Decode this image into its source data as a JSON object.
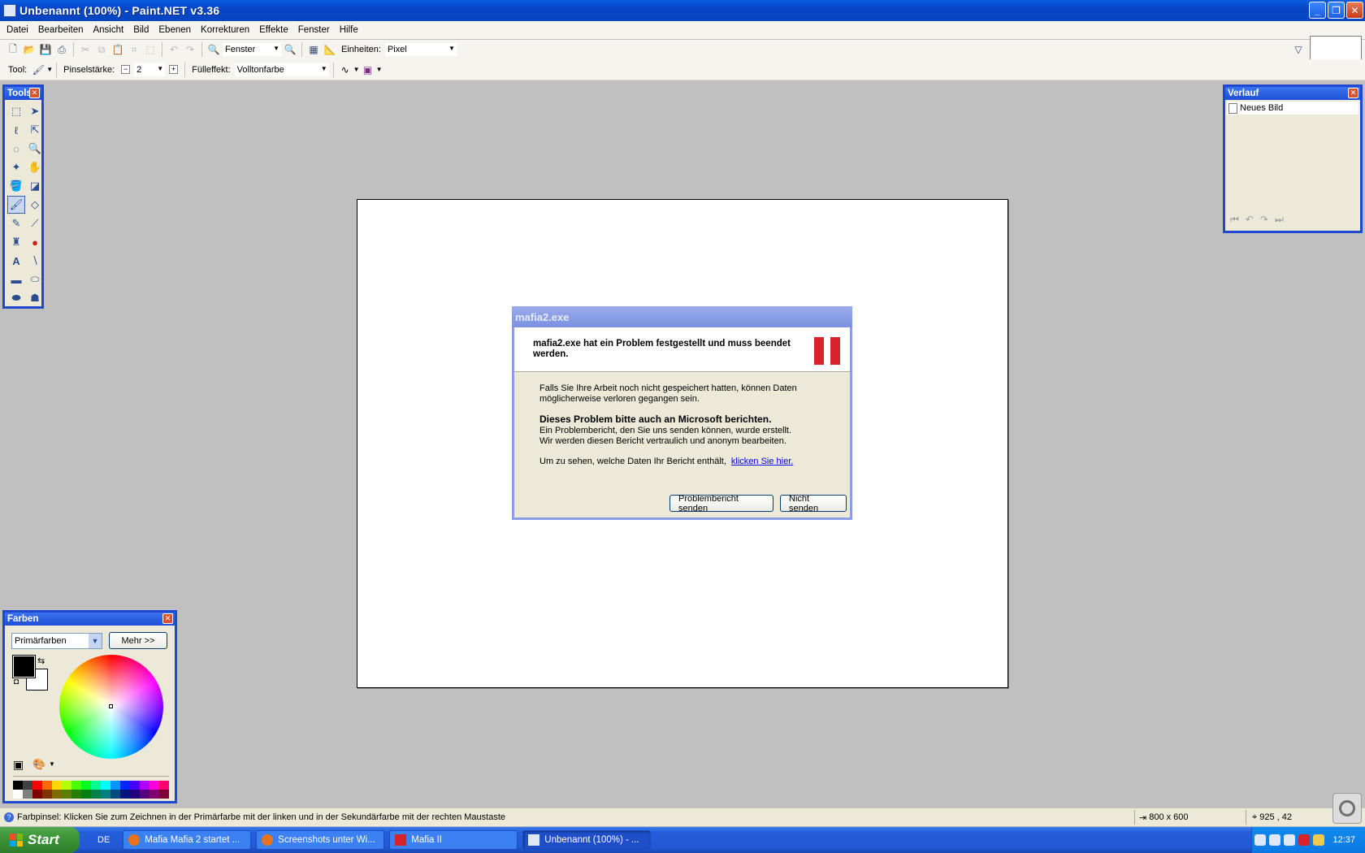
{
  "window": {
    "title": "Unbenannt (100%) - Paint.NET v3.36",
    "minimize": "_",
    "restore": "❐",
    "close": "✕"
  },
  "menu": [
    "Datei",
    "Bearbeiten",
    "Ansicht",
    "Bild",
    "Ebenen",
    "Korrekturen",
    "Effekte",
    "Fenster",
    "Hilfe"
  ],
  "toolbar1": {
    "zoom_value": "Fenster",
    "units_label": "Einheiten:",
    "units_value": "Pixel"
  },
  "toolbar2": {
    "tool_label": "Tool:",
    "brush_width_label": "Pinselstärke:",
    "brush_width_value": "2",
    "fill_label": "Fülleffekt:",
    "fill_value": "Volltonfarbe"
  },
  "tools_panel": {
    "title": "Tools",
    "active_tool": "paintbrush-tool"
  },
  "history_panel": {
    "title": "Verlauf",
    "items": [
      "Neues Bild"
    ]
  },
  "colors_panel": {
    "title": "Farben",
    "mode_value": "Primärfarben",
    "more_button": "Mehr >>",
    "primary_color": "#000000",
    "secondary_color": "#ffffff",
    "palette": [
      "#000000",
      "#404040",
      "#ff0000",
      "#ff6a00",
      "#ffd800",
      "#b6ff00",
      "#4cff00",
      "#00ff21",
      "#00ff90",
      "#00ffff",
      "#0094ff",
      "#0026ff",
      "#4800ff",
      "#b200ff",
      "#ff00dc",
      "#ff006e",
      "#ffffff",
      "#808080",
      "#7f0000",
      "#7f3300",
      "#7f6a00",
      "#5b7f00",
      "#267f00",
      "#007f0e",
      "#007f46",
      "#007f7f",
      "#004a7f",
      "#00137f",
      "#21007f",
      "#57007f",
      "#7f006e",
      "#7f0037"
    ]
  },
  "dialog": {
    "title": "mafia2.exe",
    "heading": "mafia2.exe hat ein Problem festgestellt und muss beendet werden.",
    "para1": "Falls Sie Ihre Arbeit noch nicht gespeichert hatten, können Daten möglicherweise verloren gegangen sein.",
    "subheading": "Dieses Problem bitte auch an Microsoft berichten.",
    "para2": "Ein Problembericht, den Sie uns senden können, wurde erstellt. Wir werden diesen Bericht vertraulich und anonym bearbeiten.",
    "para3": "Um zu sehen, welche Daten Ihr Bericht enthält,",
    "link": "klicken Sie hier.",
    "send_button": "Problembericht senden",
    "dont_send_button": "Nicht senden"
  },
  "statusbar": {
    "hint": "Farbpinsel: Klicken Sie zum Zeichnen in der Primärfarbe mit der linken und in der Sekundärfarbe mit der rechten Maustaste",
    "image_size": "800 x 600",
    "cursor_pos": "925 , 42"
  },
  "taskbar": {
    "start": "Start",
    "language": "DE",
    "tasks": [
      {
        "label": "Mafia Mafia 2 startet ...",
        "icon_color": "#e8731a"
      },
      {
        "label": "Screenshots unter Wi...",
        "icon_color": "#e8731a"
      },
      {
        "label": "Mafia II",
        "icon_color": "#d8232a"
      },
      {
        "label": "Unbenannt (100%) - ...",
        "icon_color": "#dfe8f7"
      }
    ],
    "clock": "12:37"
  }
}
